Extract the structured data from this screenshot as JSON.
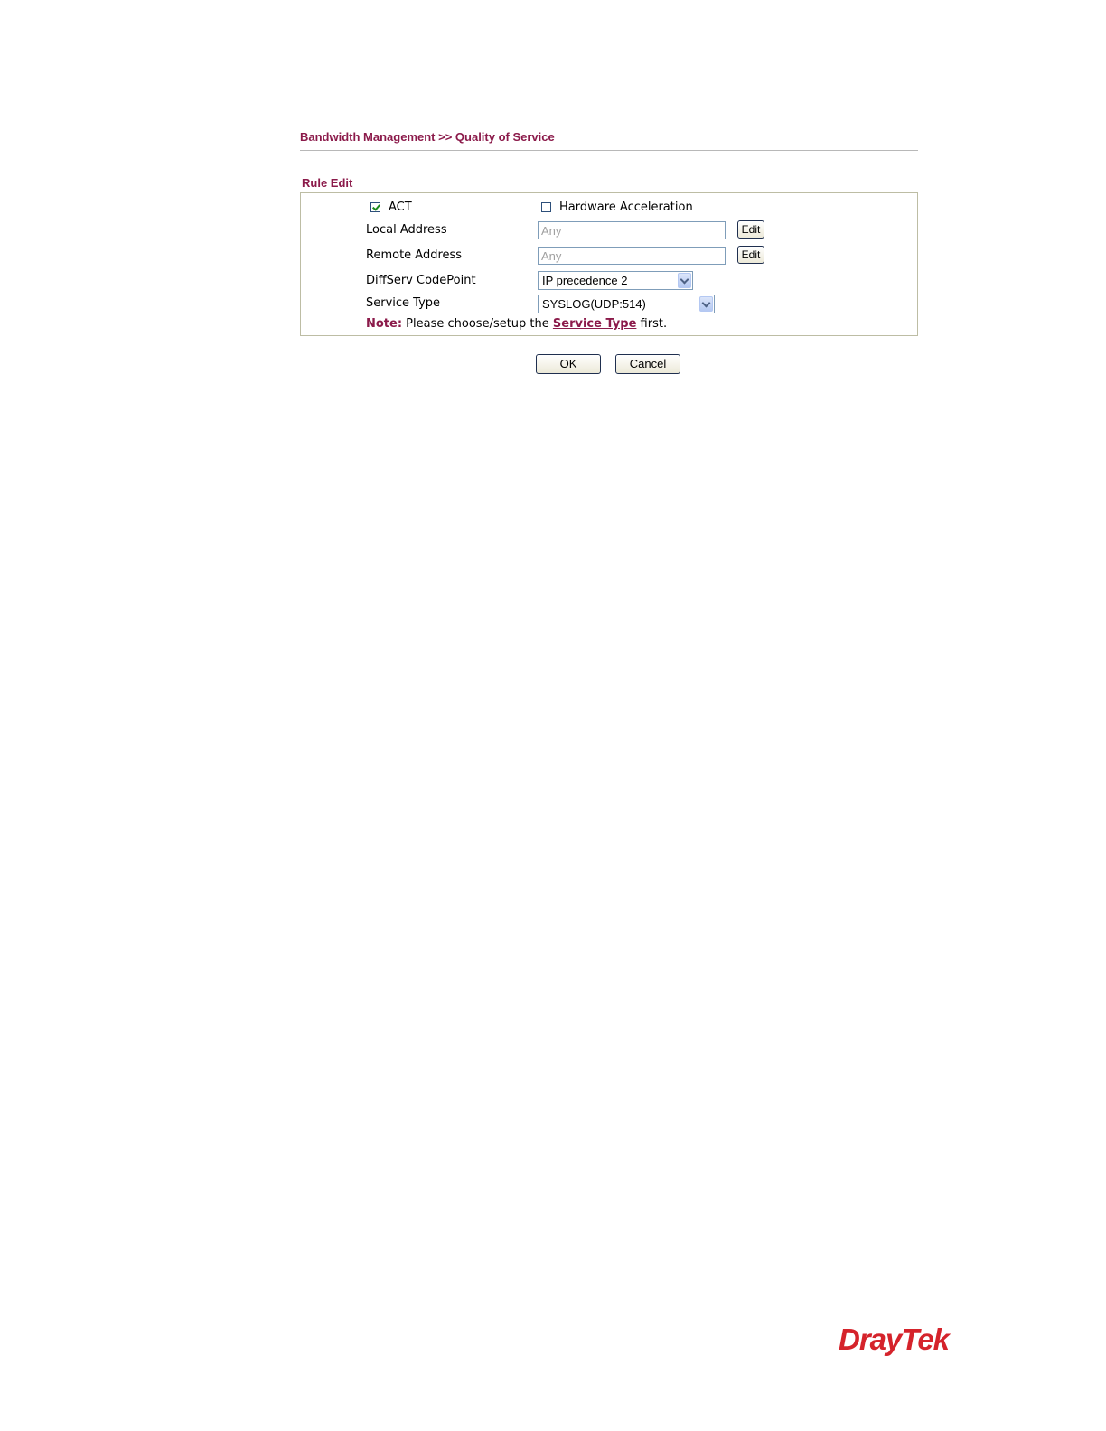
{
  "breadcrumb": "Bandwidth Management >> Quality of Service",
  "section_title": "Rule Edit",
  "form": {
    "act": {
      "label": "ACT",
      "checked": true
    },
    "hardware_acceleration": {
      "label": "Hardware Acceleration",
      "checked": false
    },
    "local_address": {
      "label": "Local Address",
      "value": "Any",
      "edit_label": "Edit"
    },
    "remote_address": {
      "label": "Remote Address",
      "value": "Any",
      "edit_label": "Edit"
    },
    "diffserv": {
      "label": "DiffServ CodePoint",
      "selected": "IP precedence 2"
    },
    "service_type": {
      "label": "Service Type",
      "selected": "SYSLOG(UDP:514)"
    },
    "note": {
      "prefix": "Note:",
      "text_before": " Please choose/setup the ",
      "link": "Service Type",
      "text_after": " first."
    }
  },
  "buttons": {
    "ok": "OK",
    "cancel": "Cancel"
  },
  "footer": {
    "logo": "DrayTek"
  },
  "colors": {
    "accent": "#8b1a4a",
    "logo": "#d5232b"
  }
}
